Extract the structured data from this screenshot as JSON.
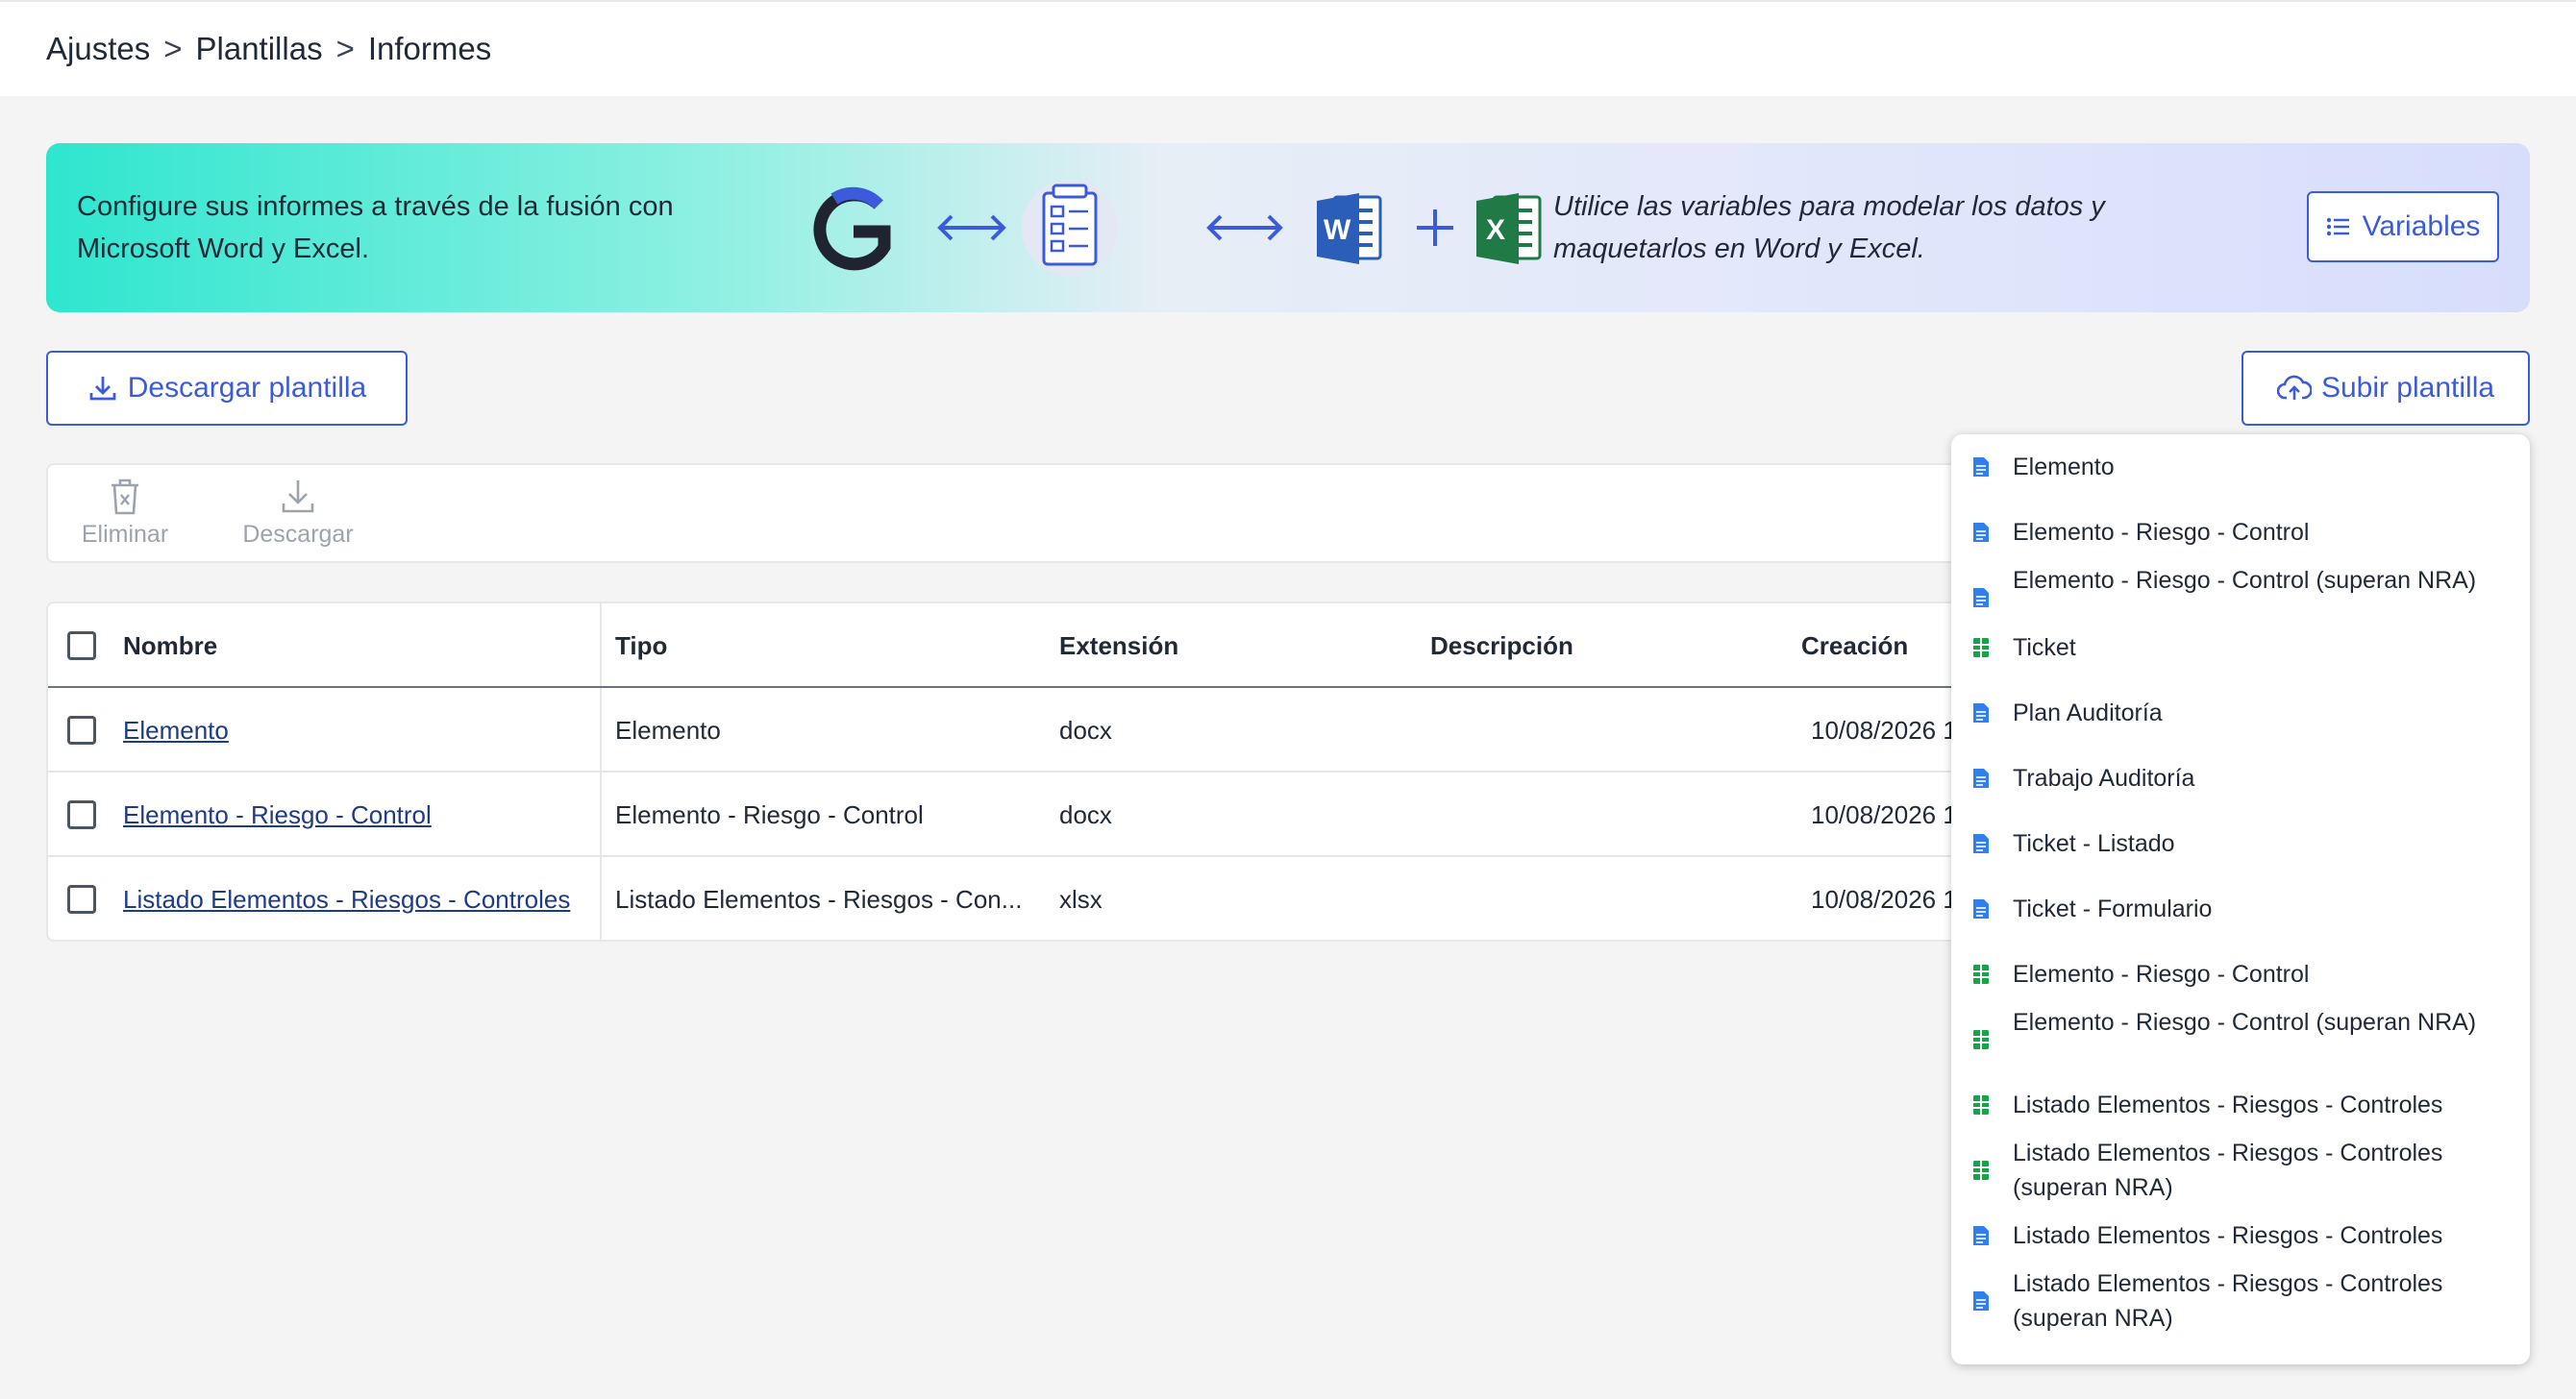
{
  "breadcrumb": {
    "items": [
      "Ajustes",
      "Plantillas",
      "Informes"
    ],
    "separator": ">"
  },
  "banner": {
    "left_text": "Configure sus informes a través de la fusión con Microsoft Word y Excel.",
    "right_text": "Utilice las variables para modelar los datos y maquetarlos en Word y Excel.",
    "variables_button": "Variables",
    "icons": [
      "g-logo-icon",
      "double-arrow-icon",
      "template-form-icon",
      "double-arrow-icon",
      "word-icon",
      "plus-icon",
      "excel-icon"
    ]
  },
  "actions": {
    "download_template": "Descargar plantilla",
    "upload_template": "Subir plantilla"
  },
  "toolbar": {
    "delete": "Eliminar",
    "download": "Descargar"
  },
  "table": {
    "columns": [
      "Nombre",
      "Tipo",
      "Extensión",
      "Descripción",
      "Creación"
    ],
    "rows": [
      {
        "nombre": "Elemento",
        "tipo": "Elemento",
        "extension": "docx",
        "descripcion": "",
        "creacion": "10/08/2026 1"
      },
      {
        "nombre": "Elemento - Riesgo - Control",
        "tipo": "Elemento - Riesgo - Control",
        "extension": "docx",
        "descripcion": "",
        "creacion": "10/08/2026 1"
      },
      {
        "nombre": "Listado Elementos - Riesgos - Controles",
        "tipo": "Listado Elementos - Riesgos - Con...",
        "extension": "xlsx",
        "descripcion": "",
        "creacion": "10/08/2026 1"
      }
    ]
  },
  "upload_menu": {
    "items": [
      {
        "label": "Elemento",
        "icon": "word-doc-icon"
      },
      {
        "label": "Elemento - Riesgo - Control",
        "icon": "word-doc-icon"
      },
      {
        "label": "Elemento - Riesgo - Control (superan NRA)",
        "icon": "word-doc-icon"
      },
      {
        "label": "Ticket",
        "icon": "excel-sheet-icon"
      },
      {
        "label": "Plan Auditoría",
        "icon": "word-doc-icon"
      },
      {
        "label": "Trabajo Auditoría",
        "icon": "word-doc-icon"
      },
      {
        "label": "Ticket - Listado",
        "icon": "word-doc-icon"
      },
      {
        "label": "Ticket - Formulario",
        "icon": "word-doc-icon"
      },
      {
        "label": "Elemento - Riesgo - Control",
        "icon": "excel-sheet-icon"
      },
      {
        "label": "Elemento - Riesgo - Control (superan NRA)",
        "icon": "excel-sheet-icon"
      },
      {
        "label": "Listado Elementos - Riesgos - Controles",
        "icon": "excel-sheet-icon"
      },
      {
        "label": "Listado Elementos - Riesgos - Controles (superan NRA)",
        "icon": "excel-sheet-icon"
      },
      {
        "label": "Listado Elementos - Riesgos - Controles",
        "icon": "word-doc-icon"
      },
      {
        "label": "Listado Elementos - Riesgos - Controles (superan NRA)",
        "icon": "word-doc-icon"
      }
    ]
  },
  "colors": {
    "accent": "#3b5bdb",
    "link": "#1e3a8a",
    "doc_icon": "#2f80ed",
    "sheet_icon": "#16a34a"
  }
}
